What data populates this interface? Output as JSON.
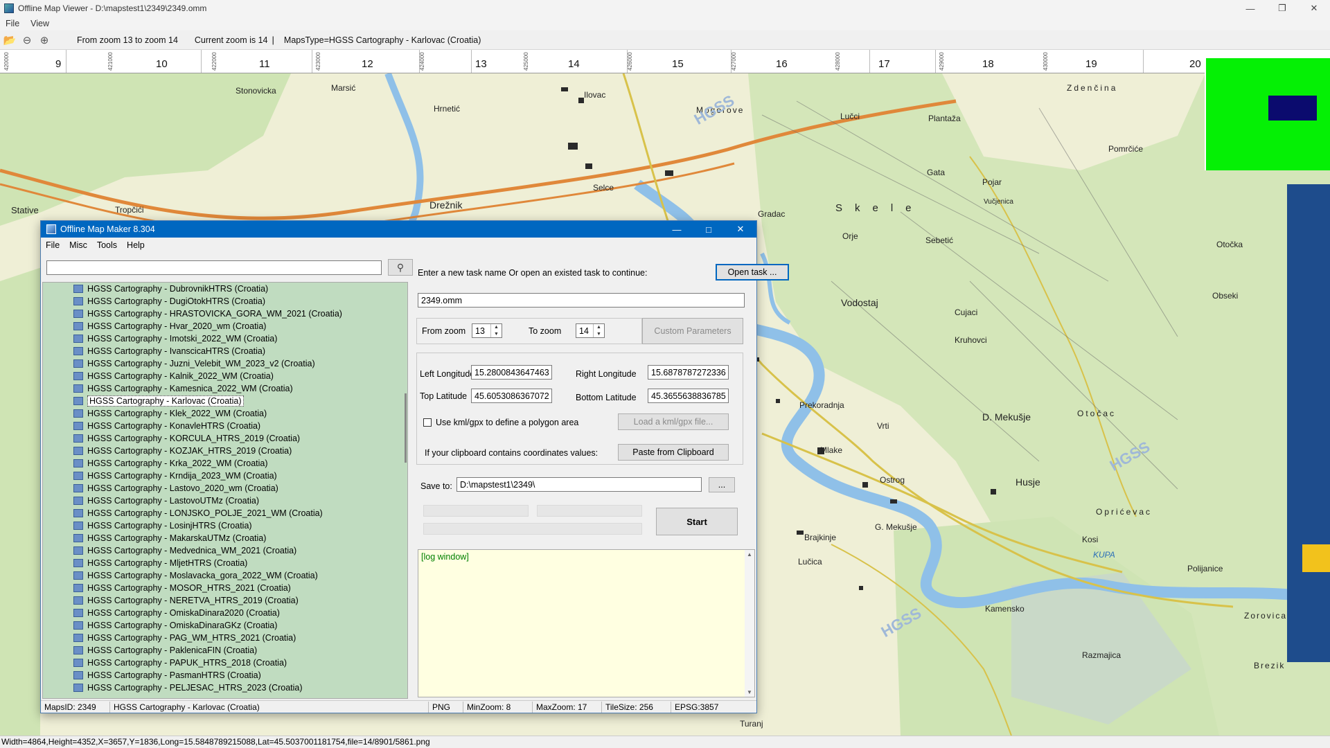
{
  "viewer": {
    "title": "Offline Map Viewer - D:\\mapstest1\\2349\\2349.omm",
    "menu": [
      "File",
      "View"
    ],
    "toolbar": {
      "zoom_range": "From zoom 13 to zoom 14",
      "current_zoom": "Current zoom is 14",
      "maps_type": "MapsType=HGSS Cartography - Karlovac (Croatia)",
      "separator": "|"
    },
    "ruler_numbers": [
      "9",
      "10",
      "11",
      "12",
      "13",
      "14",
      "15",
      "16",
      "17",
      "18",
      "19",
      "20"
    ],
    "ruler_small_labels": [
      "420000",
      "421000",
      "422000",
      "423000",
      "424000",
      "425000",
      "426000",
      "427000",
      "428000",
      "429000",
      "430000"
    ],
    "status": "Width=4864,Height=4352,X=3657,Y=1836,Long=15.5848789215088,Lat=45.5037001181754,file=14/8901/5861.png",
    "map_labels": [
      "Stonovicka",
      "Marsić",
      "Ilovac",
      "Zdenčina",
      "Mogorove",
      "Lučci",
      "Plantaža",
      "Hrnetić",
      "Pomrčiće",
      "Drežnik",
      "Selce",
      "Gata",
      "Pojar",
      "Vučjenica",
      "Skele",
      "Orje",
      "Sebetić",
      "Vodostaj",
      "Cujaci",
      "Kruhovci",
      "Otočka",
      "Obseki",
      "Prekoradnja",
      "Vrti",
      "D. Mekušje",
      "Otočac",
      "Husje",
      "Ostrog",
      "Oprićevac",
      "G. Mekušje",
      "Brajkinje",
      "Mlake",
      "Kosi",
      "Polijanice",
      "Lučica",
      "Kamensko",
      "Razmajica",
      "Brezik",
      "Turanj",
      "Zorovica",
      "Stative",
      "Tropčići",
      "Gradac",
      "KUPA",
      "HGSS"
    ],
    "map_colors": {
      "water": "#8fc0e8",
      "green": "#cfe4b4",
      "land": "#eeeed6",
      "road_yellow": "#d8c24a",
      "road_orange": "#e0883a",
      "overview_bg": "#05f005",
      "overview_vp": "#0b0b6e"
    }
  },
  "dialog": {
    "title": "Offline Map Maker 8.304",
    "menu": [
      "File",
      "Misc",
      "Tools",
      "Help"
    ],
    "search": {
      "value": "",
      "button_icon": "search-icon"
    },
    "map_items": [
      "HGSS Cartography - DubrovnikHTRS (Croatia)",
      "HGSS Cartography - DugiOtokHTRS (Croatia)",
      "HGSS Cartography - HRASTOVICKA_GORA_WM_2021 (Croatia)",
      "HGSS Cartography - Hvar_2020_wm (Croatia)",
      "HGSS Cartography - Imotski_2022_WM (Croatia)",
      "HGSS Cartography - IvanscicaHTRS (Croatia)",
      "HGSS Cartography - Juzni_Velebit_WM_2023_v2 (Croatia)",
      "HGSS Cartography - Kalnik_2022_WM (Croatia)",
      "HGSS Cartography - Kamesnica_2022_WM (Croatia)",
      "HGSS Cartography - Karlovac (Croatia)",
      "HGSS Cartography - Klek_2022_WM (Croatia)",
      "HGSS Cartography - KonavleHTRS (Croatia)",
      "HGSS Cartography - KORCULA_HTRS_2019 (Croatia)",
      "HGSS Cartography - KOZJAK_HTRS_2019 (Croatia)",
      "HGSS Cartography - Krka_2022_WM (Croatia)",
      "HGSS Cartography - Krndija_2023_WM (Croatia)",
      "HGSS Cartography - Lastovo_2020_wm (Croatia)",
      "HGSS Cartography - LastovoUTMz (Croatia)",
      "HGSS Cartography - LONJSKO_POLJE_2021_WM (Croatia)",
      "HGSS Cartography - LosinjHTRS (Croatia)",
      "HGSS Cartography - MakarskaUTMz (Croatia)",
      "HGSS Cartography - Medvednica_WM_2021 (Croatia)",
      "HGSS Cartography - MljetHTRS (Croatia)",
      "HGSS Cartography - Moslavacka_gora_2022_WM (Croatia)",
      "HGSS Cartography - MOSOR_HTRS_2021 (Croatia)",
      "HGSS Cartography - NERETVA_HTRS_2019 (Croatia)",
      "HGSS Cartography - OmiskaDinara2020 (Croatia)",
      "HGSS Cartography - OmiskaDinaraGKz (Croatia)",
      "HGSS Cartography - PAG_WM_HTRS_2021 (Croatia)",
      "HGSS Cartography - PaklenicaFIN (Croatia)",
      "HGSS Cartography - PAPUK_HTRS_2018 (Croatia)",
      "HGSS Cartography - PasmanHTRS (Croatia)",
      "HGSS Cartography - PELJESAC_HTRS_2023 (Croatia)"
    ],
    "selected_item": "HGSS Cartography - Karlovac (Croatia)",
    "task_prompt": "Enter a new task name Or open an existed task to continue:",
    "open_task_label": "Open task ...",
    "task_name": "2349.omm",
    "from_zoom_label": "From zoom",
    "from_zoom": "13",
    "to_zoom_label": "To zoom",
    "to_zoom": "14",
    "custom_params_label": "Custom Parameters",
    "left_lon_label": "Left Longitude",
    "left_lon": "15.2800843647463",
    "right_lon_label": "Right Longitude",
    "right_lon": "15.6878787272336",
    "top_lat_label": "Top Latitude",
    "top_lat": "45.6053086367072",
    "bottom_lat_label": "Bottom Latitude",
    "bottom_lat": "45.3655638836785",
    "kml_label": "Use kml/gpx to define a polygon area",
    "kml_checked": false,
    "load_kml_label": "Load a kml/gpx file...",
    "clipboard_prompt": "If your clipboard contains coordinates values:",
    "paste_label": "Paste from Clipboard",
    "save_to_label": "Save to:",
    "save_to": "D:\\mapstest1\\2349\\",
    "browse_label": "...",
    "start_label": "Start",
    "log_text": "[log window]",
    "status": {
      "maps_id": "MapsID: 2349",
      "map_name": "HGSS Cartography - Karlovac (Croatia)",
      "format": "PNG",
      "min_zoom": "MinZoom: 8",
      "max_zoom": "MaxZoom: 17",
      "tile_size": "TileSize: 256",
      "epsg": "EPSG:3857"
    }
  }
}
